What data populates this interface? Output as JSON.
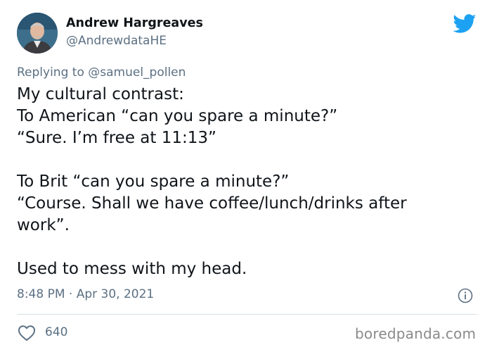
{
  "author": {
    "name": "Andrew Hargreaves",
    "handle": "@AndrewdataHE"
  },
  "reply": {
    "prefix": "Replying to ",
    "target": "@samuel_pollen"
  },
  "tweet": {
    "lines": [
      "My cultural contrast:",
      "To American “can you spare a minute?”",
      "“Sure. I’m free at 11:13”",
      "",
      "To Brit “can you spare a minute?”",
      "“Course. Shall we have coffee/lunch/drinks after",
      "work”.",
      "",
      "Used to mess with my head."
    ],
    "timestamp": "8:48 PM · Apr 30, 2021"
  },
  "engagement": {
    "likes": "640"
  },
  "watermark": "boredpanda.com",
  "icons": {
    "brand": "twitter-bird-icon",
    "info": "info-icon",
    "like": "heart-icon"
  },
  "colors": {
    "brand": "#1da1f2",
    "text": "#0f1419",
    "secondary": "#5b7083",
    "divider": "#d5dde3",
    "watermark": "#8a8a8a"
  }
}
